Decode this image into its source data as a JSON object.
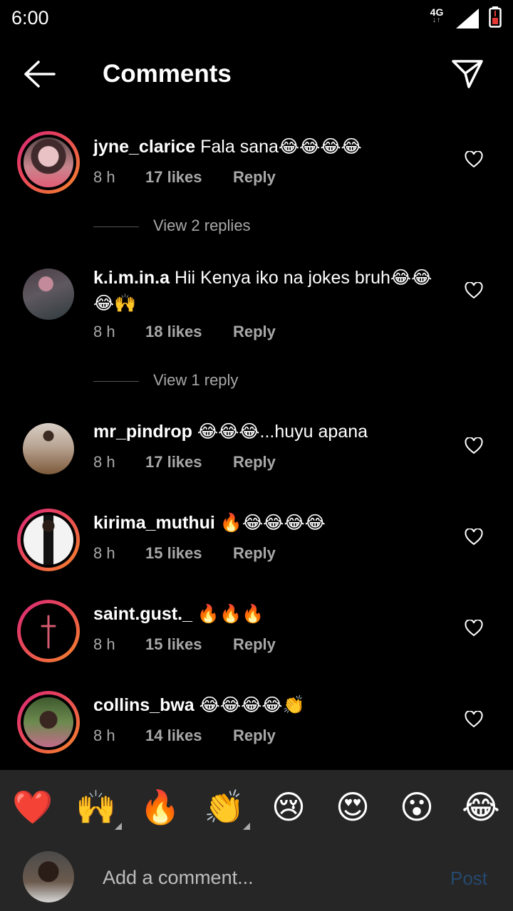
{
  "status_bar": {
    "time": "6:00",
    "network": "4G",
    "network_arrows": "↓↑"
  },
  "header": {
    "title": "Comments"
  },
  "comments": [
    {
      "username": "jyne_clarice",
      "text": "Fala sana😂😂😂😂",
      "time": "8 h",
      "likes": "17 likes",
      "reply": "Reply"
    },
    {
      "username": "k.i.m.in.a",
      "text": "Hii Kenya iko na jokes bruh😂😂😂🙌",
      "time": "8 h",
      "likes": "18 likes",
      "reply": "Reply"
    },
    {
      "username": "mr_pindrop",
      "text": "😂😂😂...huyu apana",
      "time": "8 h",
      "likes": "17 likes",
      "reply": "Reply"
    },
    {
      "username": "kirima_muthui",
      "text": "🔥😂😂😂😂",
      "time": "8 h",
      "likes": "15 likes",
      "reply": "Reply"
    },
    {
      "username": "saint.gust._",
      "text": "🔥🔥🔥",
      "time": "8 h",
      "likes": "15 likes",
      "reply": "Reply"
    },
    {
      "username": "collins_bwa",
      "text": "😂😂😂😂👏",
      "time": "8 h",
      "likes": "14 likes",
      "reply": "Reply"
    }
  ],
  "view_replies": [
    "View 2 replies",
    "View 1 reply"
  ],
  "emoji_bar": [
    "❤️",
    "🙌",
    "🔥",
    "👏",
    "😢",
    "😍",
    "😮",
    "😂"
  ],
  "composer": {
    "placeholder": "Add a comment...",
    "post_label": "Post"
  },
  "colors": {
    "background": "#000000",
    "muted_text": "#a8a8a8",
    "emoji_bar_bg": "#262626",
    "post_disabled": "#25496e",
    "story_ring_start": "#d62976",
    "story_ring_end": "#f58529"
  }
}
